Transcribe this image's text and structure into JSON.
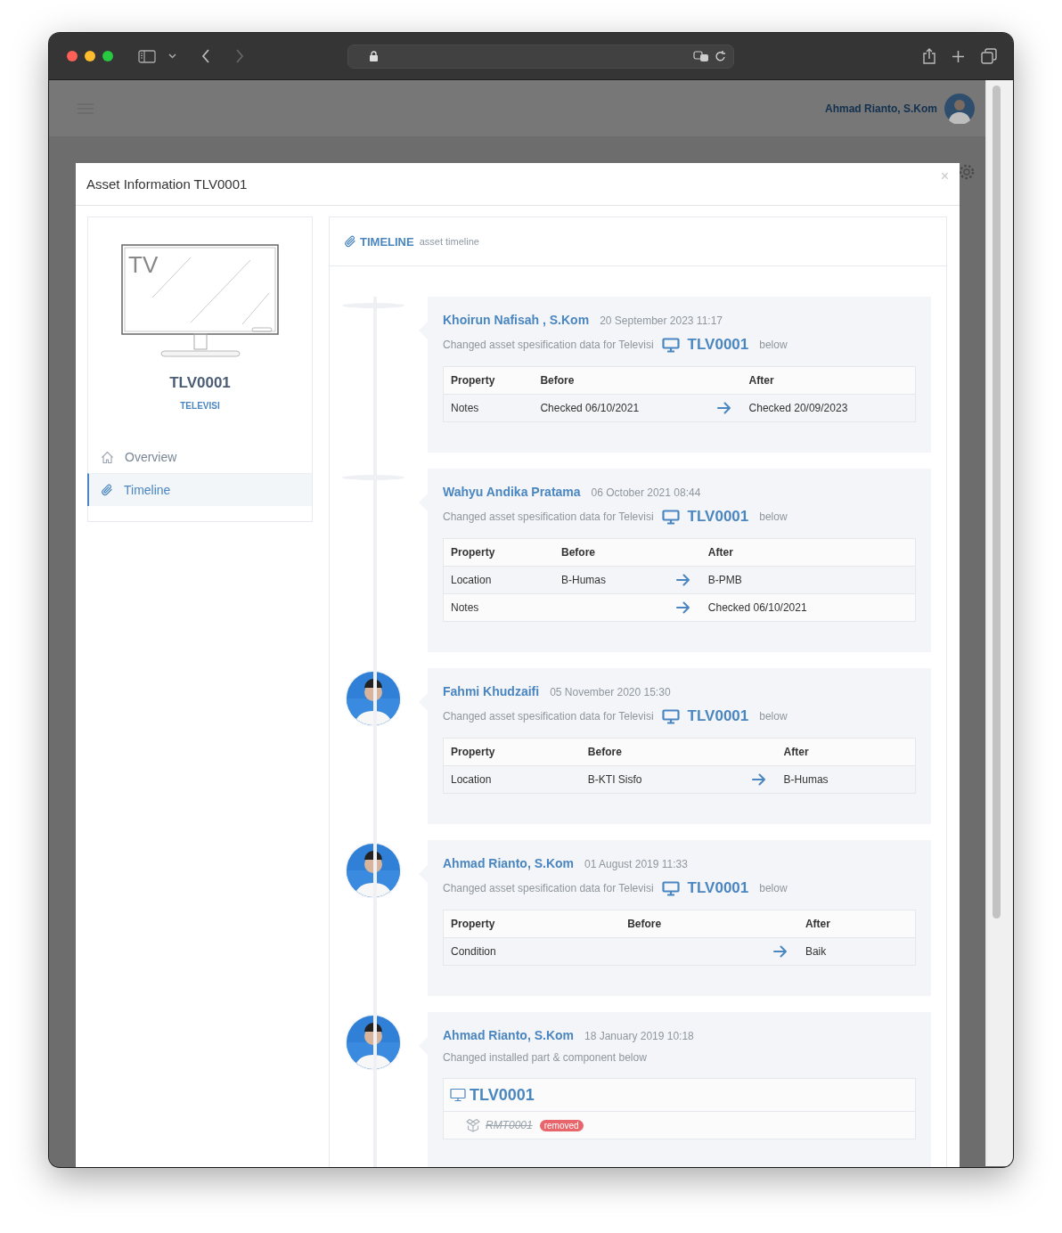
{
  "app_header": {
    "user_name": "Ahmad Rianto, S.Kom"
  },
  "modal": {
    "title": "Asset Information TLV0001",
    "close": "×"
  },
  "asset": {
    "code": "TLV0001",
    "category": "TELEVISI",
    "image_label": "TV"
  },
  "sidebar": {
    "items": [
      {
        "label": "Overview",
        "selected": false
      },
      {
        "label": "Timeline",
        "selected": true
      }
    ]
  },
  "timeline": {
    "title": "TIMELINE",
    "subtitle": "asset timeline",
    "items": [
      {
        "kind": "spec",
        "avatar": false,
        "user": "Khoirun Nafisah , S.Kom",
        "date": "20 September 2023 11:17",
        "description": "Changed asset spesification data for Televisi",
        "asset_code": "TLV0001",
        "suffix": "below",
        "columns": [
          "Property",
          "Before",
          "After"
        ],
        "rows": [
          [
            "Notes",
            "Checked 06/10/2021",
            "Checked 20/09/2023"
          ]
        ]
      },
      {
        "kind": "spec",
        "avatar": false,
        "user": "Wahyu Andika Pratama",
        "date": "06 October 2021 08:44",
        "description": "Changed asset spesification data for Televisi",
        "asset_code": "TLV0001",
        "suffix": "below",
        "columns": [
          "Property",
          "Before",
          "After"
        ],
        "rows": [
          [
            "Location",
            "B-Humas",
            "B-PMB"
          ],
          [
            "Notes",
            "",
            "Checked 06/10/2021"
          ]
        ]
      },
      {
        "kind": "spec",
        "avatar": true,
        "user": "Fahmi Khudzaifi",
        "date": "05 November 2020 15:30",
        "description": "Changed asset spesification data for Televisi",
        "asset_code": "TLV0001",
        "suffix": "below",
        "columns": [
          "Property",
          "Before",
          "After"
        ],
        "rows": [
          [
            "Location",
            "B-KTI Sisfo",
            "B-Humas"
          ]
        ]
      },
      {
        "kind": "spec",
        "avatar": true,
        "user": "Ahmad Rianto, S.Kom",
        "date": "01 August 2019 11:33",
        "description": "Changed asset spesification data for Televisi",
        "asset_code": "TLV0001",
        "suffix": "below",
        "columns": [
          "Property",
          "Before",
          "After"
        ],
        "rows": [
          [
            "Condition",
            "",
            "Baik"
          ]
        ]
      },
      {
        "kind": "parts",
        "avatar": true,
        "user": "Ahmad Rianto, S.Kom",
        "date": "18 January 2019 10:18",
        "description": "Changed installed part & component below",
        "asset_code": "TLV0001",
        "parts": [
          {
            "code": "RMT0001",
            "status": "removed"
          }
        ]
      }
    ]
  }
}
